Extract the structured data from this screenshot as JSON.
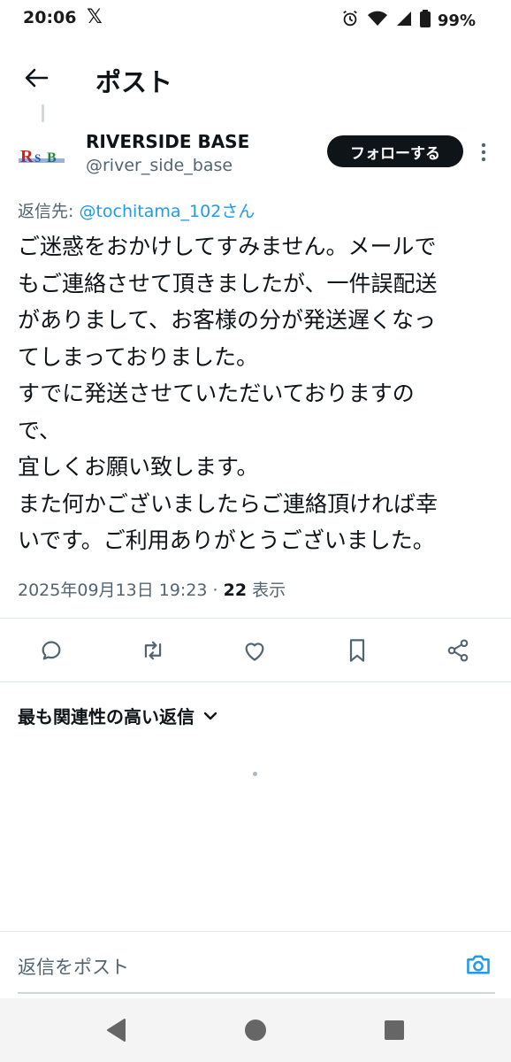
{
  "status_bar": {
    "time": "20:06",
    "x_glyph": "𝕏",
    "battery_pct": "99%",
    "icons": [
      "alarm-icon",
      "wifi-icon",
      "signal-icon",
      "battery-icon"
    ]
  },
  "header": {
    "title": "ポスト",
    "back_icon": "arrow-left-icon"
  },
  "tweet": {
    "author_name": "RIVERSIDE BASE",
    "author_handle": "@river_side_base",
    "avatar_text": "RSB",
    "follow_label": "フォローする",
    "reply_to_prefix": "返信先: ",
    "reply_to_mention": "@tochitama_102さん",
    "body_lines": [
      "ご迷惑をおかけしてすみません。メールで",
      "もご連絡させて頂きましたが、一件誤配送",
      "がありまして、お客様の分が発送遅くなっ",
      "てしまっておりました。",
      "すでに発送させていただいておりますの",
      "で、",
      "宜しくお願い致します。",
      "また何かございましたらご連絡頂ければ幸",
      "いです。ご利用ありがとうございました。"
    ],
    "timestamp": "2025年09月13日 19:23 · ",
    "view_count": "22",
    "view_label": " 表示"
  },
  "actions": [
    "reply-icon",
    "retweet-icon",
    "like-icon",
    "bookmark-icon",
    "share-icon"
  ],
  "replies": {
    "sort_label": "最も関連性の高い返信"
  },
  "composer": {
    "placeholder": "返信をポスト"
  },
  "colors": {
    "accent": "#1d9bf0",
    "text": "#0f1419",
    "muted": "#536471"
  }
}
